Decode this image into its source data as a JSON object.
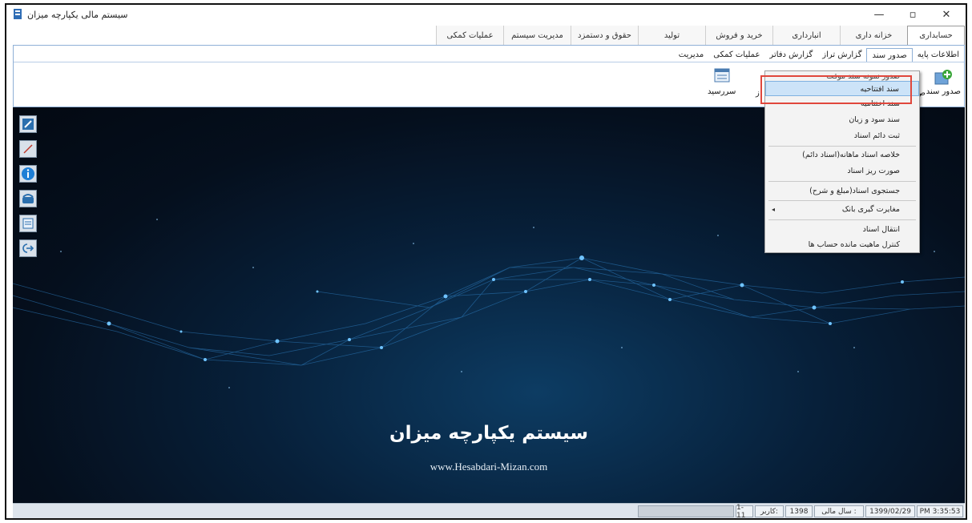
{
  "window": {
    "title": "سیستم مالی یکپارچه میزان",
    "controls": {
      "minimize": "—",
      "maximize": "▫",
      "close": "✕"
    }
  },
  "main_menu": {
    "tabs": [
      {
        "label": "حسابداری"
      },
      {
        "label": "خزانه داری"
      },
      {
        "label": "انبارداری"
      },
      {
        "label": "خرید و فروش"
      },
      {
        "label": "تولید"
      },
      {
        "label": "حقوق و دستمزد"
      },
      {
        "label": "مدیریت سیستم"
      },
      {
        "label": "عملیات کمکی"
      }
    ]
  },
  "ribbon": {
    "sub_tabs": [
      {
        "label": "اطلاعات پایه"
      },
      {
        "label": "صدور سند"
      },
      {
        "label": "گزارش تراز"
      },
      {
        "label": "گزارش دفاتر"
      },
      {
        "label": "عملیات کمکی"
      },
      {
        "label": "مدیریت"
      }
    ],
    "buttons": {
      "issue_doc": "صدور سند",
      "due_date": "سررسید"
    },
    "partial_left": "ص",
    "partial_right": "ز"
  },
  "dropdown": {
    "header": "صدور نمونه سند موقت",
    "items": [
      {
        "label": "سند افتتاحیه"
      },
      {
        "label": "سند اختتامیه"
      },
      {
        "label": "سند سود و زیان"
      },
      {
        "label": "ثبت دائم اسناد"
      },
      {
        "label": "خلاصه اسناد ماهانه(اسناد دائم)"
      },
      {
        "label": "صورت ریز اسناد"
      },
      {
        "label": "جستجوی اسناد(مبلغ و شرح)"
      },
      {
        "label": "مغایرت گیری بانک"
      },
      {
        "label": "انتقال اسناد"
      },
      {
        "label": "کنترل ماهیت مانده حساب ها"
      }
    ],
    "submenu_arrow": "◂"
  },
  "desktop": {
    "brand_title": "سیستم یکپارچه میزان",
    "brand_url": "www.Hesabdari-Mizan.com"
  },
  "statusbar": {
    "time": "PM 3:35:53",
    "date": "1399/02/29",
    "fiscal_year_label": "سال مالی :",
    "fiscal_year": "1398",
    "user_label": "کاربر:",
    "user_value": "1-11"
  },
  "colors": {
    "highlight": "#e0473c",
    "selection": "#cce3f8",
    "ribbon_border": "#8fb0d6"
  }
}
